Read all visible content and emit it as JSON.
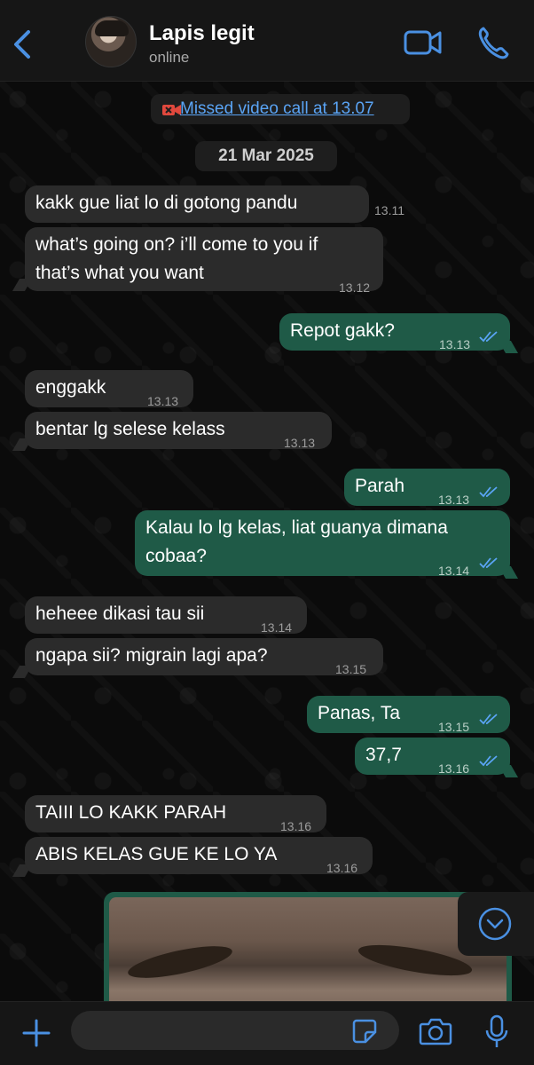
{
  "header": {
    "contact_name": "Lapis legit",
    "status": "online"
  },
  "chat": {
    "missed_call": "Missed video call at 13.07",
    "date": "21 Mar 2025",
    "messages": [
      {
        "dir": "in",
        "text": "kakk gue liat lo di gotong pandu",
        "time": "13.11"
      },
      {
        "dir": "in",
        "text_line1": "what’s going on? i’ll come to you if",
        "text_line2": "that’s what you want",
        "time": "13.12"
      },
      {
        "dir": "out",
        "text": "Repot gakk?",
        "time": "13.13"
      },
      {
        "dir": "in",
        "text": "enggakk",
        "time": "13.13"
      },
      {
        "dir": "in",
        "text": "bentar lg selese kelass",
        "time": "13.13"
      },
      {
        "dir": "out",
        "text": "Parah",
        "time": "13.13"
      },
      {
        "dir": "out",
        "text_line1": "Kalau lo lg kelas, liat guanya dimana",
        "text_line2": "cobaa?",
        "time": "13.14"
      },
      {
        "dir": "in",
        "text": "heheee dikasi tau sii",
        "time": "13.14"
      },
      {
        "dir": "in",
        "text": "ngapa sii? migrain lagi apa?",
        "time": "13.15"
      },
      {
        "dir": "out",
        "text": "Panas, Ta",
        "time": "13.15"
      },
      {
        "dir": "out",
        "text": "37,7",
        "time": "13.16"
      },
      {
        "dir": "in",
        "text": "TAIII LO KAKK PARAH",
        "time": "13.16"
      },
      {
        "dir": "in",
        "text": "ABIS KELAS GUE KE LO YA",
        "time": "13.16"
      }
    ]
  },
  "colors": {
    "incoming_bubble": "#2b2b2b",
    "outgoing_bubble": "#1f5a47",
    "accent": "#4a90e2",
    "read_ticks": "#5aa4f5"
  },
  "footer": {
    "input_placeholder": ""
  },
  "icons": [
    "back-chevron-icon",
    "video-call-icon",
    "phone-icon",
    "missed-video-icon",
    "double-check-icon",
    "scroll-down-icon",
    "plus-icon",
    "sticker-icon",
    "camera-icon",
    "microphone-icon"
  ]
}
